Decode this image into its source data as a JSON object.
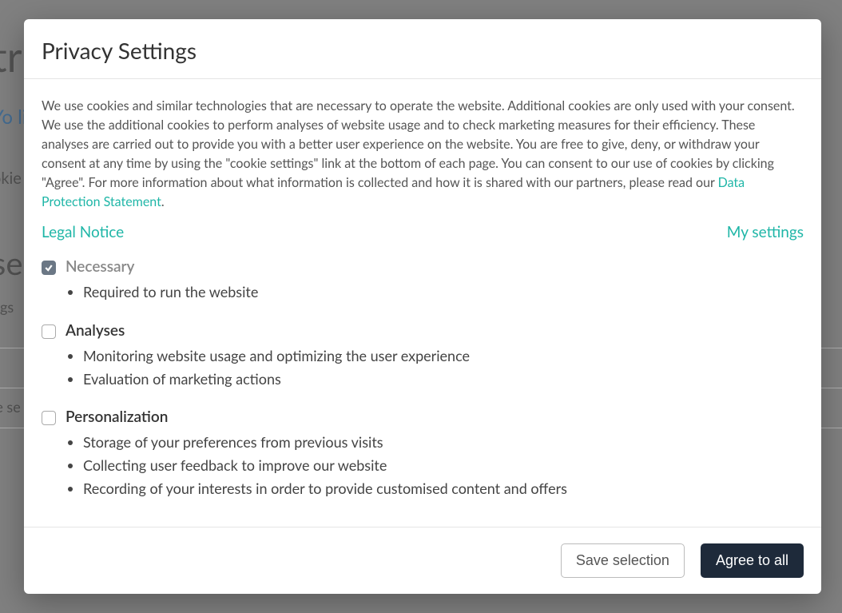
{
  "bg": {
    "heading": "tr                                                                                                                                                          ar",
    "sub": "Yo\nlis",
    "cookie": "okie",
    "heading2": "se",
    "sub2": "ngs",
    "row": "ie se"
  },
  "modal": {
    "title": "Privacy Settings",
    "intro_text_pre": "We use cookies and similar technologies that are necessary to operate the website. Additional cookies are only used with your consent. We use the additional cookies to perform analyses of website usage and to check marketing measures for their efficiency. These analyses are carried out to provide you with a better user experience on the website. You are free to give, deny, or withdraw your consent at any time by using the \"cookie settings\" link at the bottom of each page. You can consent to our use of cookies by clicking \"Agree\". For more information about what information is collected and how it is shared with our partners, please read our ",
    "intro_link": "Data Protection Statement",
    "intro_text_post": ".",
    "legal_notice": "Legal Notice",
    "my_settings": "My settings",
    "options": {
      "necessary": {
        "title": "Necessary",
        "items": [
          "Required to run the website"
        ]
      },
      "analyses": {
        "title": "Analyses",
        "items": [
          "Monitoring website usage and optimizing the user experience",
          "Evaluation of marketing actions"
        ]
      },
      "personalization": {
        "title": "Personalization",
        "items": [
          "Storage of your preferences from previous visits",
          "Collecting user feedback to improve our website",
          "Recording of your interests in order to provide customised content and offers"
        ]
      }
    },
    "buttons": {
      "save": "Save selection",
      "agree": "Agree to all"
    }
  }
}
